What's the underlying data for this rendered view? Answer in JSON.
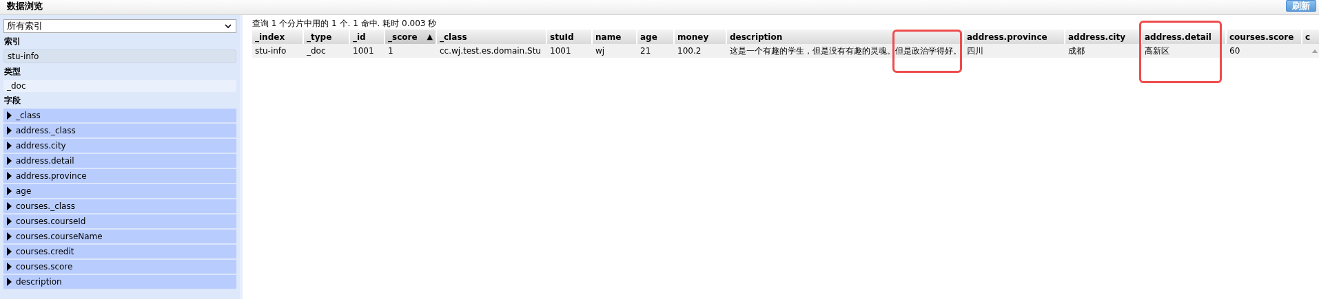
{
  "header": {
    "title": "数据浏览",
    "refresh_button": "刷新"
  },
  "sidebar": {
    "index_select": {
      "value": "所有索引"
    },
    "sections": [
      {
        "kind": "list",
        "heading": "索引",
        "items": [
          {
            "label": "stu-info",
            "selected": true
          }
        ]
      },
      {
        "kind": "list",
        "heading": "类型",
        "items": [
          {
            "label": "_doc",
            "selected": false
          }
        ]
      },
      {
        "kind": "fields",
        "heading": "字段",
        "items": [
          {
            "label": "_class",
            "expanded": false
          },
          {
            "label": "address._class",
            "expanded": false
          },
          {
            "label": "address.city",
            "expanded": false
          },
          {
            "label": "address.detail",
            "expanded": false
          },
          {
            "label": "address.province",
            "expanded": false
          },
          {
            "label": "age",
            "expanded": false
          },
          {
            "label": "courses._class",
            "expanded": false
          },
          {
            "label": "courses.courseId",
            "expanded": false
          },
          {
            "label": "courses.courseName",
            "expanded": false
          },
          {
            "label": "courses.credit",
            "expanded": false
          },
          {
            "label": "courses.score",
            "expanded": false
          },
          {
            "label": "description",
            "expanded": false
          }
        ]
      }
    ]
  },
  "results": {
    "summary": "查询 1 个分片中用的 1 个. 1 命中. 耗时 0.003 秒",
    "table": {
      "columns": [
        {
          "label": "_index",
          "sorted": false
        },
        {
          "label": "_type",
          "sorted": false
        },
        {
          "label": "_id",
          "sorted": false
        },
        {
          "label": "_score",
          "sorted": true,
          "sort_indicator": "▲"
        },
        {
          "label": "_class",
          "sorted": false
        },
        {
          "label": "stuId",
          "sorted": false
        },
        {
          "label": "name",
          "sorted": false
        },
        {
          "label": "age",
          "sorted": false
        },
        {
          "label": "money",
          "sorted": false
        },
        {
          "label": "description",
          "sorted": false
        },
        {
          "label": "address.province",
          "sorted": false
        },
        {
          "label": "address.city",
          "sorted": false
        },
        {
          "label": "address.detail",
          "sorted": false
        },
        {
          "label": "courses.score",
          "sorted": false
        },
        {
          "label": "c",
          "sorted": false
        }
      ],
      "rows": [
        [
          "stu-info",
          "_doc",
          "1001",
          "1",
          "cc.wj.test.es.domain.Stu",
          "1001",
          "wj",
          "21",
          "100.2",
          "这是一个有趣的学生，但是没有有趣的灵魂。但是政治学得好。",
          "四川",
          "成都",
          "高新区",
          "60",
          ""
        ]
      ]
    }
  }
}
